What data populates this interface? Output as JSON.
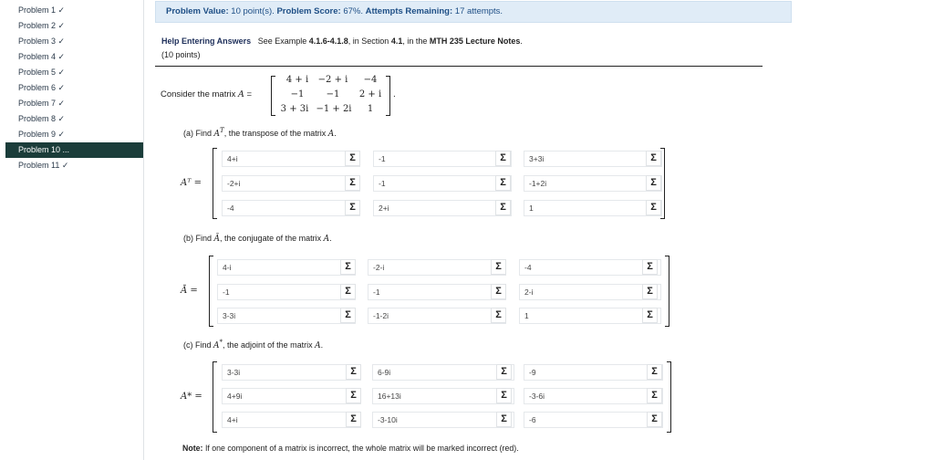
{
  "sidebar": {
    "items": [
      {
        "label": "Problem 1 ✓"
      },
      {
        "label": "Problem 2 ✓"
      },
      {
        "label": "Problem 3 ✓"
      },
      {
        "label": "Problem 4 ✓"
      },
      {
        "label": "Problem 5 ✓"
      },
      {
        "label": "Problem 6 ✓"
      },
      {
        "label": "Problem 7 ✓"
      },
      {
        "label": "Problem 8 ✓"
      },
      {
        "label": "Problem 9 ✓"
      },
      {
        "label": "Problem 10 ..."
      },
      {
        "label": "Problem 11 ✓"
      }
    ],
    "active_index": 9
  },
  "score_bar": {
    "value_label": "Problem Value:",
    "value_text": "10 point(s).",
    "score_label": "Problem Score:",
    "score_text": "67%.",
    "attempts_label": "Attempts Remaining:",
    "attempts_text": "17 attempts."
  },
  "help": {
    "link_label": "Help Entering Answers",
    "see_prefix": "See Example",
    "example_ref": "4.1.6-4.1.8",
    "in_section": ", in Section",
    "section_ref": "4.1",
    "in_the": ", in the",
    "notes_ref": "MTH 235 Lecture Notes",
    "period": ".",
    "points": "(10 points)"
  },
  "consider": {
    "prefix": "Consider the matrix",
    "symbol": "A",
    "equals": "=",
    "matrix": [
      [
        "4 + i",
        "−2 + i",
        "−4"
      ],
      [
        "−1",
        "−1",
        "2 + i"
      ],
      [
        "3 + 3i",
        "−1 + 2i",
        "1"
      ]
    ],
    "period": "."
  },
  "parts": [
    {
      "label_prefix": "(a) Find",
      "symbol": "A",
      "sup": "T",
      "label_suffix": ", the transpose of the matrix",
      "matrix_name": "A",
      "end": ".",
      "lhs": "Aᵀ =",
      "fields": [
        [
          "4+i",
          "-1",
          "3+3i"
        ],
        [
          "-2+i",
          "-1",
          "-1+2i"
        ],
        [
          "-4",
          "2+i",
          "1"
        ]
      ]
    },
    {
      "label_prefix": "(b) Find",
      "symbol": "Ā",
      "sup": "",
      "label_suffix": ", the conjugate of the matrix",
      "matrix_name": "A",
      "end": ".",
      "lhs": "Ā =",
      "fields": [
        [
          "4-i",
          "-2-i",
          "-4"
        ],
        [
          "-1",
          "-1",
          "2-i"
        ],
        [
          "3-3i",
          "-1-2i",
          "1"
        ]
      ]
    },
    {
      "label_prefix": "(c) Find",
      "symbol": "A",
      "sup": "*",
      "label_suffix": ", the adjoint of the matrix",
      "matrix_name": "A",
      "end": ".",
      "lhs": "A* =",
      "fields": [
        [
          "3-3i",
          "6-9i",
          "-9"
        ],
        [
          "4+9i",
          "16+13i",
          "-3-6i"
        ],
        [
          "4+i",
          "-3-10i",
          "-6"
        ]
      ]
    }
  ],
  "sigma_glyph": "Σ",
  "note": {
    "label": "Note:",
    "text": "If one component of a matrix is incorrect, the whole matrix will be marked incorrect (red)."
  }
}
